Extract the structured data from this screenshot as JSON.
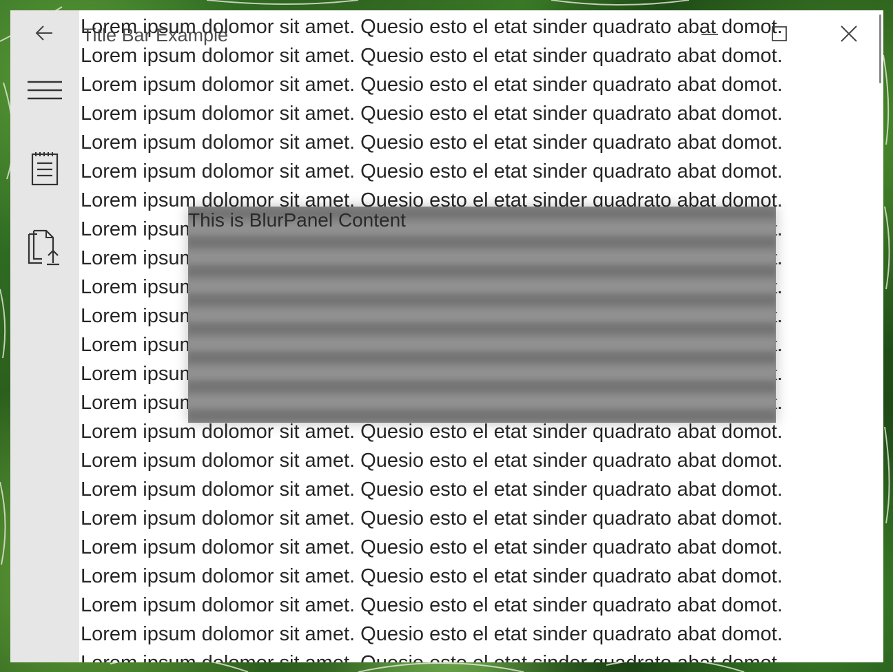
{
  "window": {
    "title": "Title Bar Example"
  },
  "nav": {
    "back_icon": "arrow-left-icon",
    "menu_icon": "hamburger-menu-icon",
    "items": [
      {
        "icon": "notepad-icon"
      },
      {
        "icon": "document-upload-icon"
      }
    ]
  },
  "caption_buttons": {
    "minimize_icon": "minimize-icon",
    "maximize_icon": "maximize-icon",
    "close_icon": "close-icon"
  },
  "content": {
    "lines": [
      "Lorem ipsum dolomor sit amet. Quesio esto el etat sinder quadrato abat domot.",
      "Lorem ipsum dolomor sit amet. Quesio esto el etat sinder quadrato abat domot.",
      "Lorem ipsum dolomor sit amet. Quesio esto el etat sinder quadrato abat domot.",
      "Lorem ipsum dolomor sit amet. Quesio esto el etat sinder quadrato abat domot.",
      "Lorem ipsum dolomor sit amet. Quesio esto el etat sinder quadrato abat domot.",
      "Lorem ipsum dolomor sit amet. Quesio esto el etat sinder quadrato abat domot.",
      "Lorem ipsum dolomor sit amet. Quesio esto el etat sinder quadrato abat domot.",
      "Lorem ipsum dolomor sit amet. Quesio esto el etat sinder quadrato abat domot.",
      "Lorem ipsum dolomor sit amet. Quesio esto el etat sinder quadrato abat domot.",
      "Lorem ipsum dolomor sit amet. Quesio esto el etat sinder quadrato abat domot.",
      "Lorem ipsum dolomor sit amet. Quesio esto el etat sinder quadrato abat domot.",
      "Lorem ipsum dolomor sit amet. Quesio esto el etat sinder quadrato abat domot.",
      "Lorem ipsum dolomor sit amet. Quesio esto el etat sinder quadrato abat domot.",
      "Lorem ipsum dolomor sit amet. Quesio esto el etat sinder quadrato abat domot.",
      "Lorem ipsum dolomor sit amet. Quesio esto el etat sinder quadrato abat domot.",
      "Lorem ipsum dolomor sit amet. Quesio esto el etat sinder quadrato abat domot.",
      "Lorem ipsum dolomor sit amet. Quesio esto el etat sinder quadrato abat domot.",
      "Lorem ipsum dolomor sit amet. Quesio esto el etat sinder quadrato abat domot.",
      "Lorem ipsum dolomor sit amet. Quesio esto el etat sinder quadrato abat domot.",
      "Lorem ipsum dolomor sit amet. Quesio esto el etat sinder quadrato abat domot.",
      "Lorem ipsum dolomor sit amet. Quesio esto el etat sinder quadrato abat domot.",
      "Lorem ipsum dolomor sit amet. Quesio esto el etat sinder quadrato abat domot.",
      "Lorem ipsum dolomor sit amet. Quesio esto el etat sinder quadrato abat domot."
    ]
  },
  "blur_panel": {
    "text": "This is BlurPanel Content"
  },
  "colors": {
    "nav_background": "#e6e6e6",
    "content_background": "#ffffff",
    "text": "#262626",
    "blur_panel": "#8a8a8a"
  }
}
